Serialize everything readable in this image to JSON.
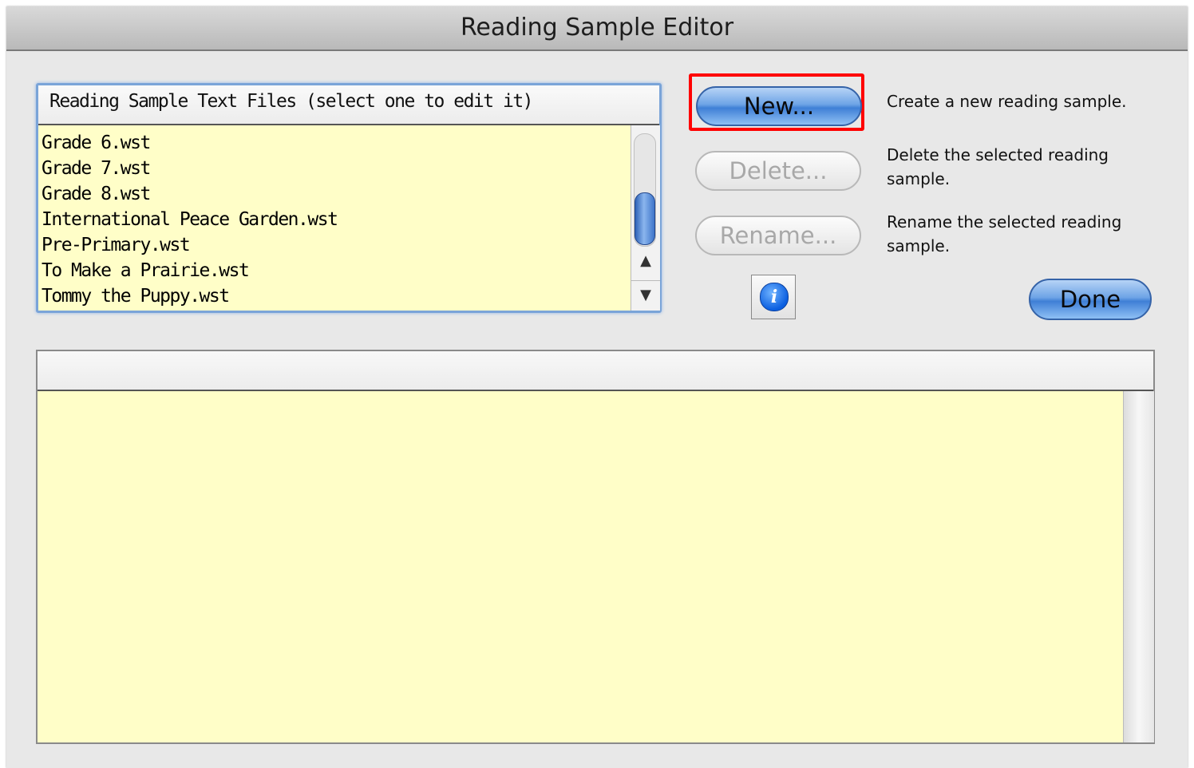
{
  "window": {
    "title": "Reading Sample Editor"
  },
  "file_list": {
    "header": "Reading Sample Text Files (select one to edit it)",
    "items": [
      "Grade 6.wst",
      "Grade 7.wst",
      "Grade 8.wst",
      "International Peace Garden.wst",
      "Pre-Primary.wst",
      "To Make a Prairie.wst",
      "Tommy the Puppy.wst"
    ],
    "scroll_up_icon": "▲",
    "scroll_down_icon": "▼"
  },
  "actions": {
    "new_label": "New...",
    "new_desc": "Create a new reading sample.",
    "delete_label": "Delete...",
    "delete_desc": "Delete the selected reading sample.",
    "rename_label": "Rename...",
    "rename_desc": "Rename the selected reading sample.",
    "info_glyph": "i",
    "done_label": "Done"
  },
  "editor": {
    "header": "",
    "content": ""
  },
  "colors": {
    "list_background": "#fffec8",
    "highlight": "#ff0000",
    "accent_blue": "#3f7fd6"
  }
}
